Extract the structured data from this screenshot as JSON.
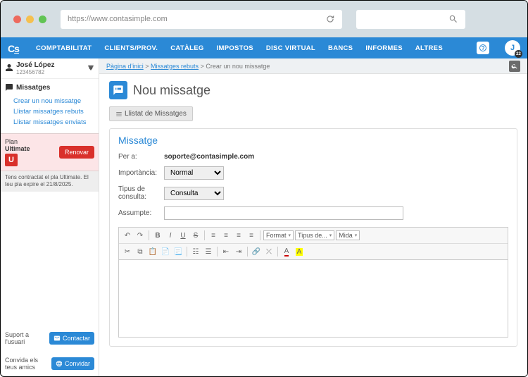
{
  "browser": {
    "url": "https://www.contasimple.com"
  },
  "menu": {
    "items": [
      "COMPTABILITAT",
      "CLIENTS/PROV.",
      "CATÀLEG",
      "IMPOSTOS",
      "DISC VIRTUAL",
      "BANCS",
      "INFORMES",
      "ALTRES"
    ],
    "avatar_letter": "J",
    "badge": "22"
  },
  "sidebar": {
    "user_name": "José López",
    "user_id": "123456782",
    "messages_label": "Missatges",
    "links": [
      "Crear un nou missatge",
      "Llistar missatges rebuts",
      "Llistar missatges enviats"
    ],
    "plan_label": "Plan",
    "plan_name": "Ultimate",
    "plan_letter": "U",
    "renew_label": "Renovar",
    "plan_note": "Tens contractat el pla Ultimate. El teu pla expire el 21/8/2025.",
    "support_label": "Suport a l'usuari",
    "contact_label": "Contactar",
    "invite_label": "Convida els teus amics",
    "invite_btn": "Convidar"
  },
  "breadcrumb": {
    "home": "Pàgina d'inici",
    "mid": "Missatges rebuts",
    "current": "Crear un nou missatge"
  },
  "page": {
    "title": "Nou missatge",
    "list_btn": "Llistat de Missatges",
    "panel_title": "Missatge",
    "to_label": "Per a:",
    "to_value": "soporte@contasimple.com",
    "importance_label": "Importància:",
    "importance_value": "Normal",
    "type_label": "Tipus de consulta:",
    "type_value": "Consulta",
    "subject_label": "Assumpte:"
  },
  "editor": {
    "format_label": "Format",
    "font_label": "Tipus de...",
    "size_label": "Mida"
  }
}
